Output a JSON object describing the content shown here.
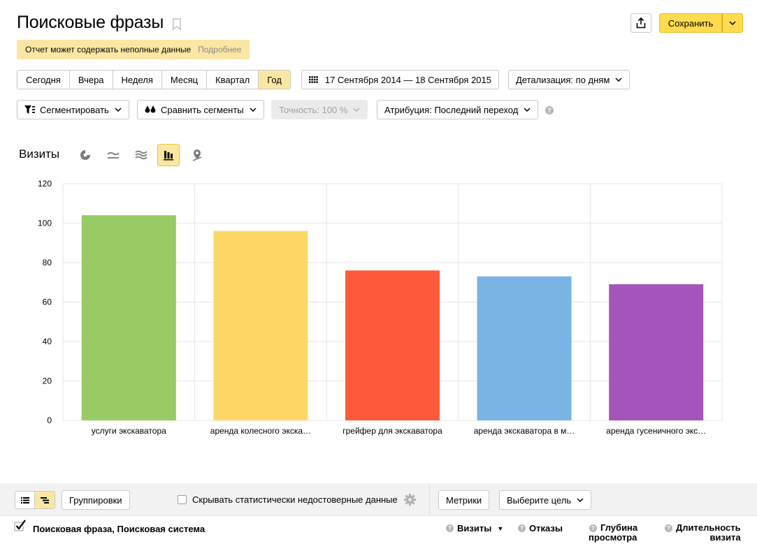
{
  "header": {
    "title": "Поисковые фразы",
    "save_label": "Сохранить"
  },
  "warning": {
    "text": "Отчет может содержать неполные данные",
    "more_link": "Подробнее"
  },
  "periods": [
    "Сегодня",
    "Вчера",
    "Неделя",
    "Месяц",
    "Квартал",
    "Год"
  ],
  "active_period": "Год",
  "date_range": "17 Сентября 2014 — 18 Сентября 2015",
  "detail": "Детализация: по дням",
  "filters": {
    "segment": "Сегментировать",
    "compare": "Сравнить сегменты",
    "accuracy": "Точность: 100 %",
    "attribution": "Атрибуция: Последний переход"
  },
  "chart_header": {
    "metric": "Визиты",
    "view_icons": [
      "pie-chart-icon",
      "line-chart-icon",
      "area-chart-icon",
      "bar-chart-icon",
      "map-icon"
    ],
    "active_view": "bar-chart-icon"
  },
  "chart_data": {
    "type": "bar",
    "categories": [
      "услуги экскаватора",
      "аренда колесного экска…",
      "грейфер для экскаватора",
      "аренда экскаватора в м…",
      "аренда гусеничного экс…"
    ],
    "values": [
      104,
      96,
      76,
      73,
      69
    ],
    "colors": [
      "#98cb63",
      "#fed766",
      "#ff5a3c",
      "#7ab4e6",
      "#a555b9"
    ],
    "ylim": [
      0,
      120
    ],
    "yticks": [
      0,
      20,
      40,
      60,
      80,
      100,
      120
    ],
    "grid": true
  },
  "bottom": {
    "groupings": "Группировки",
    "hide_label": "Скрывать статистически недостоверные данные",
    "metrics": "Метрики",
    "goal": "Выберите цель",
    "dimension": "Поисковая фраза, Поисковая система",
    "columns": {
      "visits": "Визиты",
      "bounces": "Отказы",
      "depth1": "Глубина",
      "depth2": "просмотра",
      "duration1": "Длительность",
      "duration2": "визита"
    }
  }
}
